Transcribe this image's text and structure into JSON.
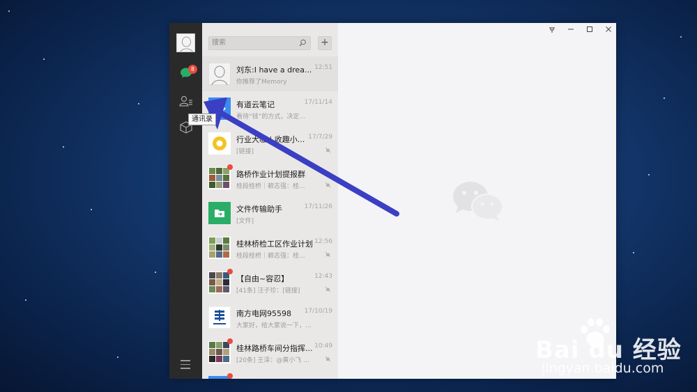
{
  "sidebar": {
    "chat_badge": "8",
    "tooltip": "通讯录"
  },
  "search": {
    "placeholder": "搜索",
    "add_label": "+"
  },
  "chats": [
    {
      "name": "刘东:I have a drea...",
      "time": "12:51",
      "preview": "你推荐了Memory",
      "dot": false,
      "mute": false
    },
    {
      "name": "有道云笔记",
      "time": "17/11/14",
      "preview": "看待“钱”的方式，决定...",
      "dot": false,
      "mute": false
    },
    {
      "name": "行业大咖 | 收趣小...",
      "time": "17/7/29",
      "preview": "[链接]",
      "dot": false,
      "mute": true
    },
    {
      "name": "路桥作业计划提报群",
      "time": "",
      "preview": "桂段桂桥｜赖志强：桂...",
      "dot": true,
      "mute": true
    },
    {
      "name": "文件传输助手",
      "time": "17/11/26",
      "preview": "[文件]",
      "dot": false,
      "mute": false
    },
    {
      "name": "桂林桥检工区作业计划",
      "time": "12:56",
      "preview": "桂段桂桥｜赖志强：桂...",
      "dot": false,
      "mute": true
    },
    {
      "name": "【自由~容忍】",
      "time": "12:43",
      "preview": "[41条] 汪子珍：[链接]",
      "dot": true,
      "mute": true
    },
    {
      "name": "南方电网95598",
      "time": "17/10/19",
      "preview": "大家好，给大家说一下，...",
      "dot": false,
      "mute": false
    },
    {
      "name": "桂林路桥车间分指挥...",
      "time": "10:49",
      "preview": "[20条] 王泽：@黄小飞 ...",
      "dot": true,
      "mute": true
    }
  ],
  "window_controls": [
    "pin",
    "minimize",
    "maximize",
    "close"
  ],
  "watermark": {
    "brand": "Bai du 经验",
    "url": "jingyan.baidu.com"
  },
  "colors": {
    "sidebar": "#2a2a2b",
    "list": "#eae8e7",
    "main": "#f4f3f5",
    "arrow": "#3a3fc4",
    "badge": "#e84c3d",
    "wechat_green": "#2aae67"
  }
}
